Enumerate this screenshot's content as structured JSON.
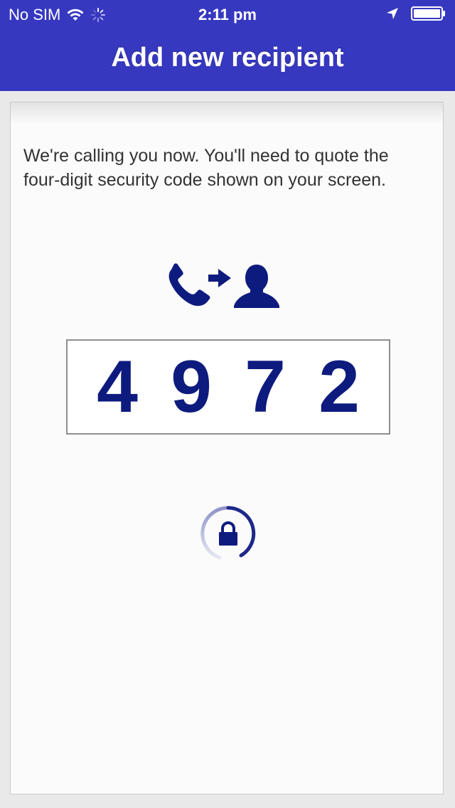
{
  "colors": {
    "brand": "#3638c0",
    "accent": "#0e1b7e"
  },
  "status_bar": {
    "carrier": "No SIM",
    "time": "2:11 pm",
    "icons": [
      "wifi-icon",
      "activity-spinner-icon",
      "location-arrow-icon",
      "battery-icon"
    ]
  },
  "header": {
    "title": "Add new recipient"
  },
  "main": {
    "message": "We're calling you now. You'll need to quote the four-digit security code shown on your screen.",
    "call_icon": "phone-to-person-icon",
    "security_code": {
      "digits": [
        "4",
        "9",
        "7",
        "2"
      ]
    },
    "loading_icon": "lock-spinner-icon"
  }
}
